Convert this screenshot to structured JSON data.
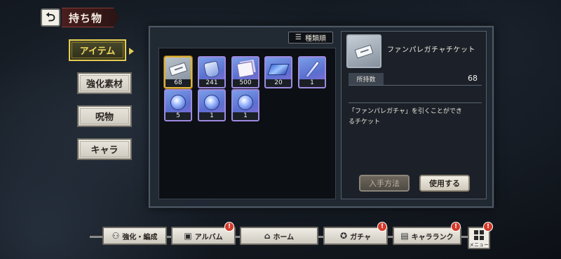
{
  "header": {
    "title": "持ち物",
    "back_icon": "back-arrow-icon"
  },
  "categories": [
    {
      "label": "アイテム",
      "active": true
    },
    {
      "label": "強化素材",
      "active": false
    },
    {
      "label": "呪物",
      "active": false
    },
    {
      "label": "キャラ",
      "active": false
    }
  ],
  "sort": {
    "icon": "sort-icon",
    "label": "種類順"
  },
  "items": [
    {
      "icon": "ticket-icon",
      "count": "68",
      "selected": true
    },
    {
      "icon": "bag-icon",
      "count": "241"
    },
    {
      "icon": "cards-icon",
      "count": "500"
    },
    {
      "icon": "cloth-icon",
      "count": "20"
    },
    {
      "icon": "wand-icon",
      "count": "1"
    },
    {
      "icon": "gem-icon",
      "count": "5"
    },
    {
      "icon": "gem-icon",
      "count": "1"
    },
    {
      "icon": "gem-icon",
      "count": "1"
    }
  ],
  "detail": {
    "icon": "ticket-icon",
    "name": "ファンパレガチャチケット",
    "owned_label": "所持数",
    "owned_value": "68",
    "description_line1": "「ファンパレガチャ」を引くことができ",
    "description_line2": "るチケット",
    "how_to_get_label": "入手方法",
    "use_label": "使用する"
  },
  "bottom_nav": [
    {
      "label": "強化・編成",
      "icon": "team-icon",
      "badge": false
    },
    {
      "label": "アルバム",
      "icon": "album-icon",
      "badge": true
    },
    {
      "label": "ホーム",
      "icon": "home-icon",
      "badge": false
    },
    {
      "label": "ガチャ",
      "icon": "gacha-icon",
      "badge": true
    },
    {
      "label": "キャラランク",
      "icon": "rank-icon",
      "badge": true
    }
  ],
  "menu": {
    "label": "メニュー",
    "badge": true
  },
  "badge_glyph": "!",
  "colors": {
    "accent_gold": "#e4cc52",
    "title_red": "#4a1e1e",
    "badge_red": "#d23a2a"
  }
}
